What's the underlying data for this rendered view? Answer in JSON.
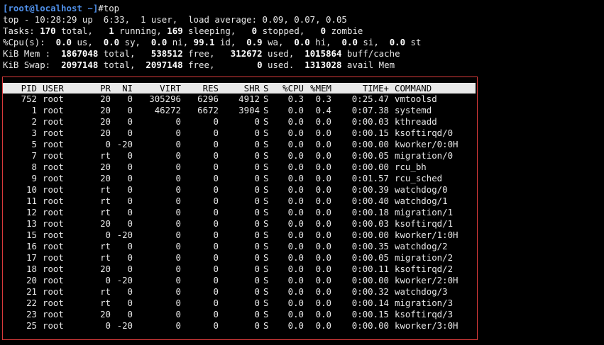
{
  "prompt": {
    "user_host": "[root@localhost ~]",
    "symbol": "#",
    "command": "top"
  },
  "summary": {
    "line1": "top - 10:28:29 up  6:33,  1 user,  load average: 0.09, 0.07, 0.05",
    "tasks": {
      "label": "Tasks: ",
      "total": "170",
      "t_total": " total,   ",
      "running": "1",
      "t_running": " running, ",
      "sleeping": "169",
      "t_sleeping": " sleeping,   ",
      "stopped": "0",
      "t_stopped": " stopped,   ",
      "zombie": "0",
      "t_zombie": " zombie"
    },
    "cpu": {
      "label": "%Cpu(s):  ",
      "us": "0.0",
      "t_us": " us,  ",
      "sy": "0.0",
      "t_sy": " sy,  ",
      "ni": "0.0",
      "t_ni": " ni, ",
      "id": "99.1",
      "t_id": " id,  ",
      "wa": "0.9",
      "t_wa": " wa,  ",
      "hi": "0.0",
      "t_hi": " hi,  ",
      "si": "0.0",
      "t_si": " si,  ",
      "st": "0.0",
      "t_st": " st"
    },
    "mem": {
      "label": "KiB Mem :  ",
      "total": "1867048",
      "t_total": " total,   ",
      "free": "538512",
      "t_free": " free,   ",
      "used": "312672",
      "t_used": " used,  ",
      "buff": "1015864",
      "t_buff": " buff/cache"
    },
    "swap": {
      "label": "KiB Swap:  ",
      "total": "2097148",
      "t_total": " total,  ",
      "free": "2097148",
      "t_free": " free,        ",
      "used": "0",
      "t_used": " used.  ",
      "avail": "1313028",
      "t_avail": " avail Mem"
    }
  },
  "columns": [
    "PID",
    "USER",
    "PR",
    "NI",
    "VIRT",
    "RES",
    "SHR",
    "S",
    "%CPU",
    "%MEM",
    "TIME+",
    "COMMAND"
  ],
  "processes": [
    [
      "752",
      "root",
      "20",
      "0",
      "305296",
      "6296",
      "4912",
      "S",
      "0.3",
      "0.3",
      "0:25.47",
      "vmtoolsd"
    ],
    [
      "1",
      "root",
      "20",
      "0",
      "46272",
      "6672",
      "3904",
      "S",
      "0.0",
      "0.4",
      "0:07.38",
      "systemd"
    ],
    [
      "2",
      "root",
      "20",
      "0",
      "0",
      "0",
      "0",
      "S",
      "0.0",
      "0.0",
      "0:00.03",
      "kthreadd"
    ],
    [
      "3",
      "root",
      "20",
      "0",
      "0",
      "0",
      "0",
      "S",
      "0.0",
      "0.0",
      "0:00.15",
      "ksoftirqd/0"
    ],
    [
      "5",
      "root",
      "0",
      "-20",
      "0",
      "0",
      "0",
      "S",
      "0.0",
      "0.0",
      "0:00.00",
      "kworker/0:0H"
    ],
    [
      "7",
      "root",
      "rt",
      "0",
      "0",
      "0",
      "0",
      "S",
      "0.0",
      "0.0",
      "0:00.05",
      "migration/0"
    ],
    [
      "8",
      "root",
      "20",
      "0",
      "0",
      "0",
      "0",
      "S",
      "0.0",
      "0.0",
      "0:00.00",
      "rcu_bh"
    ],
    [
      "9",
      "root",
      "20",
      "0",
      "0",
      "0",
      "0",
      "S",
      "0.0",
      "0.0",
      "0:01.57",
      "rcu_sched"
    ],
    [
      "10",
      "root",
      "rt",
      "0",
      "0",
      "0",
      "0",
      "S",
      "0.0",
      "0.0",
      "0:00.39",
      "watchdog/0"
    ],
    [
      "11",
      "root",
      "rt",
      "0",
      "0",
      "0",
      "0",
      "S",
      "0.0",
      "0.0",
      "0:00.40",
      "watchdog/1"
    ],
    [
      "12",
      "root",
      "rt",
      "0",
      "0",
      "0",
      "0",
      "S",
      "0.0",
      "0.0",
      "0:00.18",
      "migration/1"
    ],
    [
      "13",
      "root",
      "20",
      "0",
      "0",
      "0",
      "0",
      "S",
      "0.0",
      "0.0",
      "0:00.03",
      "ksoftirqd/1"
    ],
    [
      "15",
      "root",
      "0",
      "-20",
      "0",
      "0",
      "0",
      "S",
      "0.0",
      "0.0",
      "0:00.00",
      "kworker/1:0H"
    ],
    [
      "16",
      "root",
      "rt",
      "0",
      "0",
      "0",
      "0",
      "S",
      "0.0",
      "0.0",
      "0:00.35",
      "watchdog/2"
    ],
    [
      "17",
      "root",
      "rt",
      "0",
      "0",
      "0",
      "0",
      "S",
      "0.0",
      "0.0",
      "0:00.05",
      "migration/2"
    ],
    [
      "18",
      "root",
      "20",
      "0",
      "0",
      "0",
      "0",
      "S",
      "0.0",
      "0.0",
      "0:00.11",
      "ksoftirqd/2"
    ],
    [
      "20",
      "root",
      "0",
      "-20",
      "0",
      "0",
      "0",
      "S",
      "0.0",
      "0.0",
      "0:00.00",
      "kworker/2:0H"
    ],
    [
      "21",
      "root",
      "rt",
      "0",
      "0",
      "0",
      "0",
      "S",
      "0.0",
      "0.0",
      "0:00.32",
      "watchdog/3"
    ],
    [
      "22",
      "root",
      "rt",
      "0",
      "0",
      "0",
      "0",
      "S",
      "0.0",
      "0.0",
      "0:00.14",
      "migration/3"
    ],
    [
      "23",
      "root",
      "20",
      "0",
      "0",
      "0",
      "0",
      "S",
      "0.0",
      "0.0",
      "0:00.15",
      "ksoftirqd/3"
    ],
    [
      "25",
      "root",
      "0",
      "-20",
      "0",
      "0",
      "0",
      "S",
      "0.0",
      "0.0",
      "0:00.00",
      "kworker/3:0H"
    ]
  ],
  "colors": {
    "background": "#000000",
    "text": "#e6e6e6",
    "prompt": "#4f8fe8",
    "header_bg": "#e8e8e8",
    "highlight_frame": "#d83a3a"
  }
}
